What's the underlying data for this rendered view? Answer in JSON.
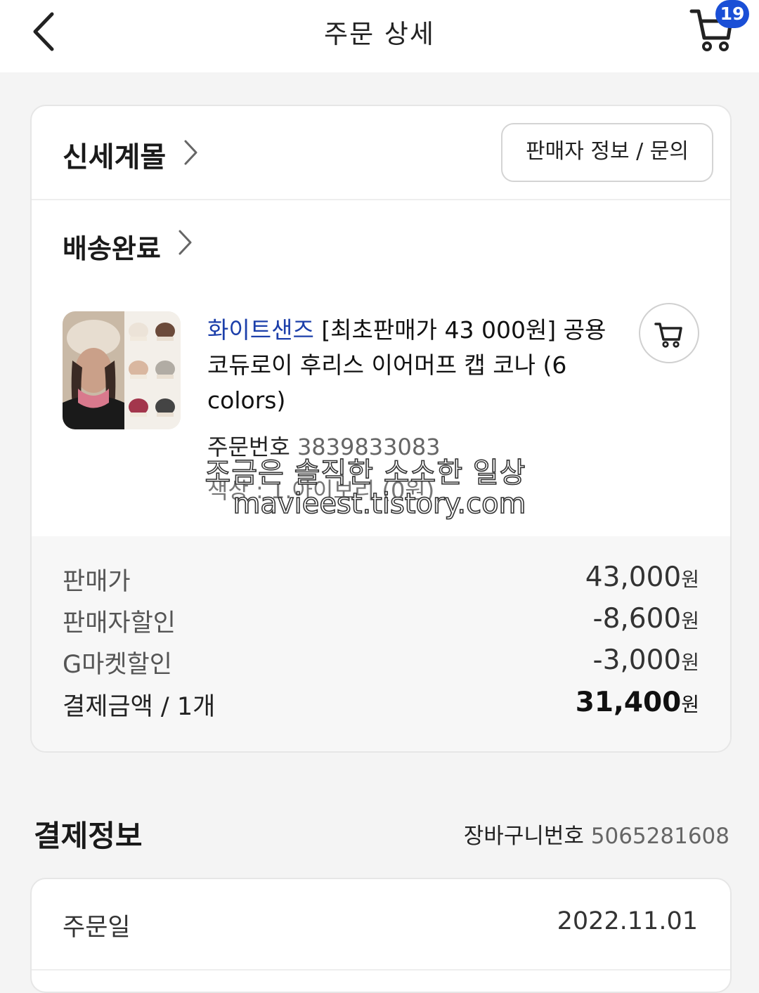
{
  "header": {
    "title": "주문 상세",
    "cart_count": "19"
  },
  "order": {
    "store_name": "신세계몰",
    "seller_button_label": "판매자 정보 / 문의",
    "status": "배송완료",
    "product": {
      "brand": "화이트샌즈",
      "title": "[최초판매가 43 000원] 공용 코듀로이 후리스 이어머프 캡 코나 (6 colors)",
      "thumbnail_icon": "product-hat-image"
    },
    "order_number_label": "주문번호",
    "order_number": "3839833083",
    "option": "색상 : 1.아이보리 (0원)"
  },
  "watermark": {
    "line1": "조금은 솔직한 소소한 일상",
    "line2": "mavieest.tistory.com"
  },
  "prices": [
    {
      "label": "판매가",
      "amount": "43,000",
      "unit": "원"
    },
    {
      "label": "판매자할인",
      "amount": "-8,600",
      "unit": "원"
    },
    {
      "label": "G마켓할인",
      "amount": "-3,000",
      "unit": "원"
    },
    {
      "label": "결제금액 / 1개",
      "amount": "31,400",
      "unit": "원"
    }
  ],
  "payment": {
    "title": "결제정보",
    "cart_number_label": "장바구니번호",
    "cart_number": "5065281608",
    "order_date_label": "주문일",
    "order_date": "2022.11.01"
  },
  "colors": {
    "brand_blue": "#1c3faa",
    "badge_blue": "#1a4fd6"
  }
}
